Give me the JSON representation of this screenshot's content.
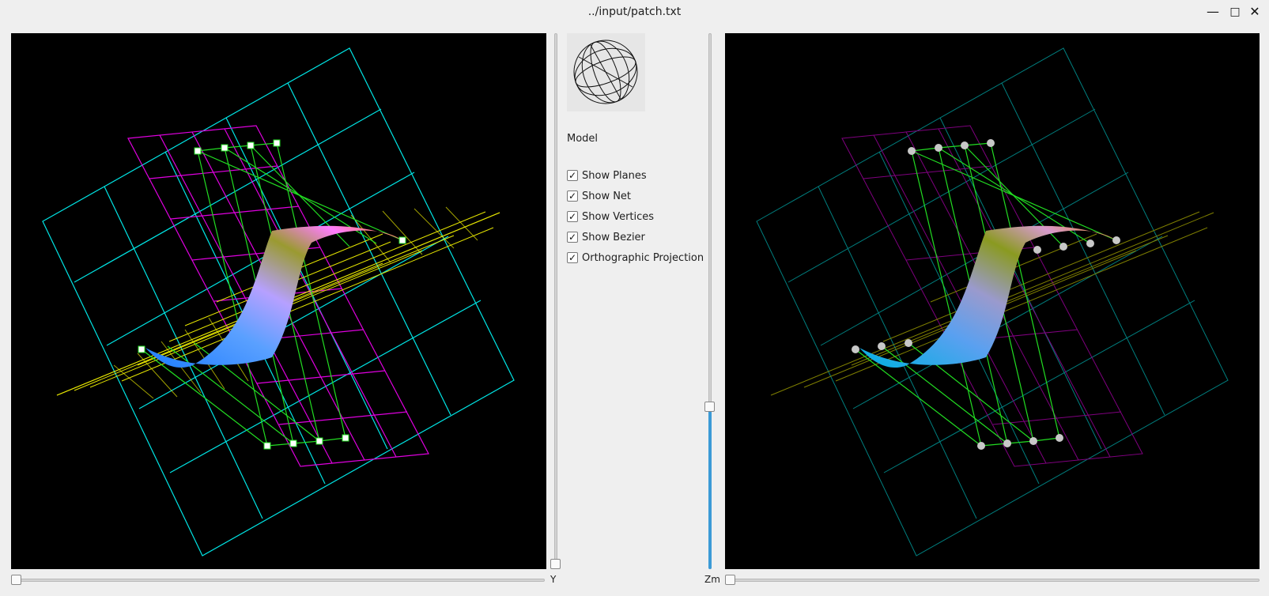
{
  "window": {
    "title": "../input/patch.txt",
    "minimize_glyph": "—",
    "maximize_glyph": "□",
    "close_glyph": "✕"
  },
  "panel": {
    "model_label": "Model",
    "options": [
      {
        "label": "Show Planes",
        "checked": true
      },
      {
        "label": "Show Net",
        "checked": true
      },
      {
        "label": "Show Vertices",
        "checked": true
      },
      {
        "label": "Show Bezier",
        "checked": true
      },
      {
        "label": "Orthographic Projection",
        "checked": true
      }
    ],
    "check_glyph": "✓"
  },
  "sliders": {
    "y_label": "Y",
    "zm_label": "Zm",
    "left_x_value": 0.0,
    "y_value": 0.0,
    "zm_value": 0.3,
    "right_x_value": 0.0
  },
  "colors": {
    "planes_primary": "#00e5e5",
    "planes_secondary": "#e000e0",
    "planes_tertiary": "#e5e500",
    "net": "#22dd22",
    "slider_accent": "#3b9ad6"
  }
}
